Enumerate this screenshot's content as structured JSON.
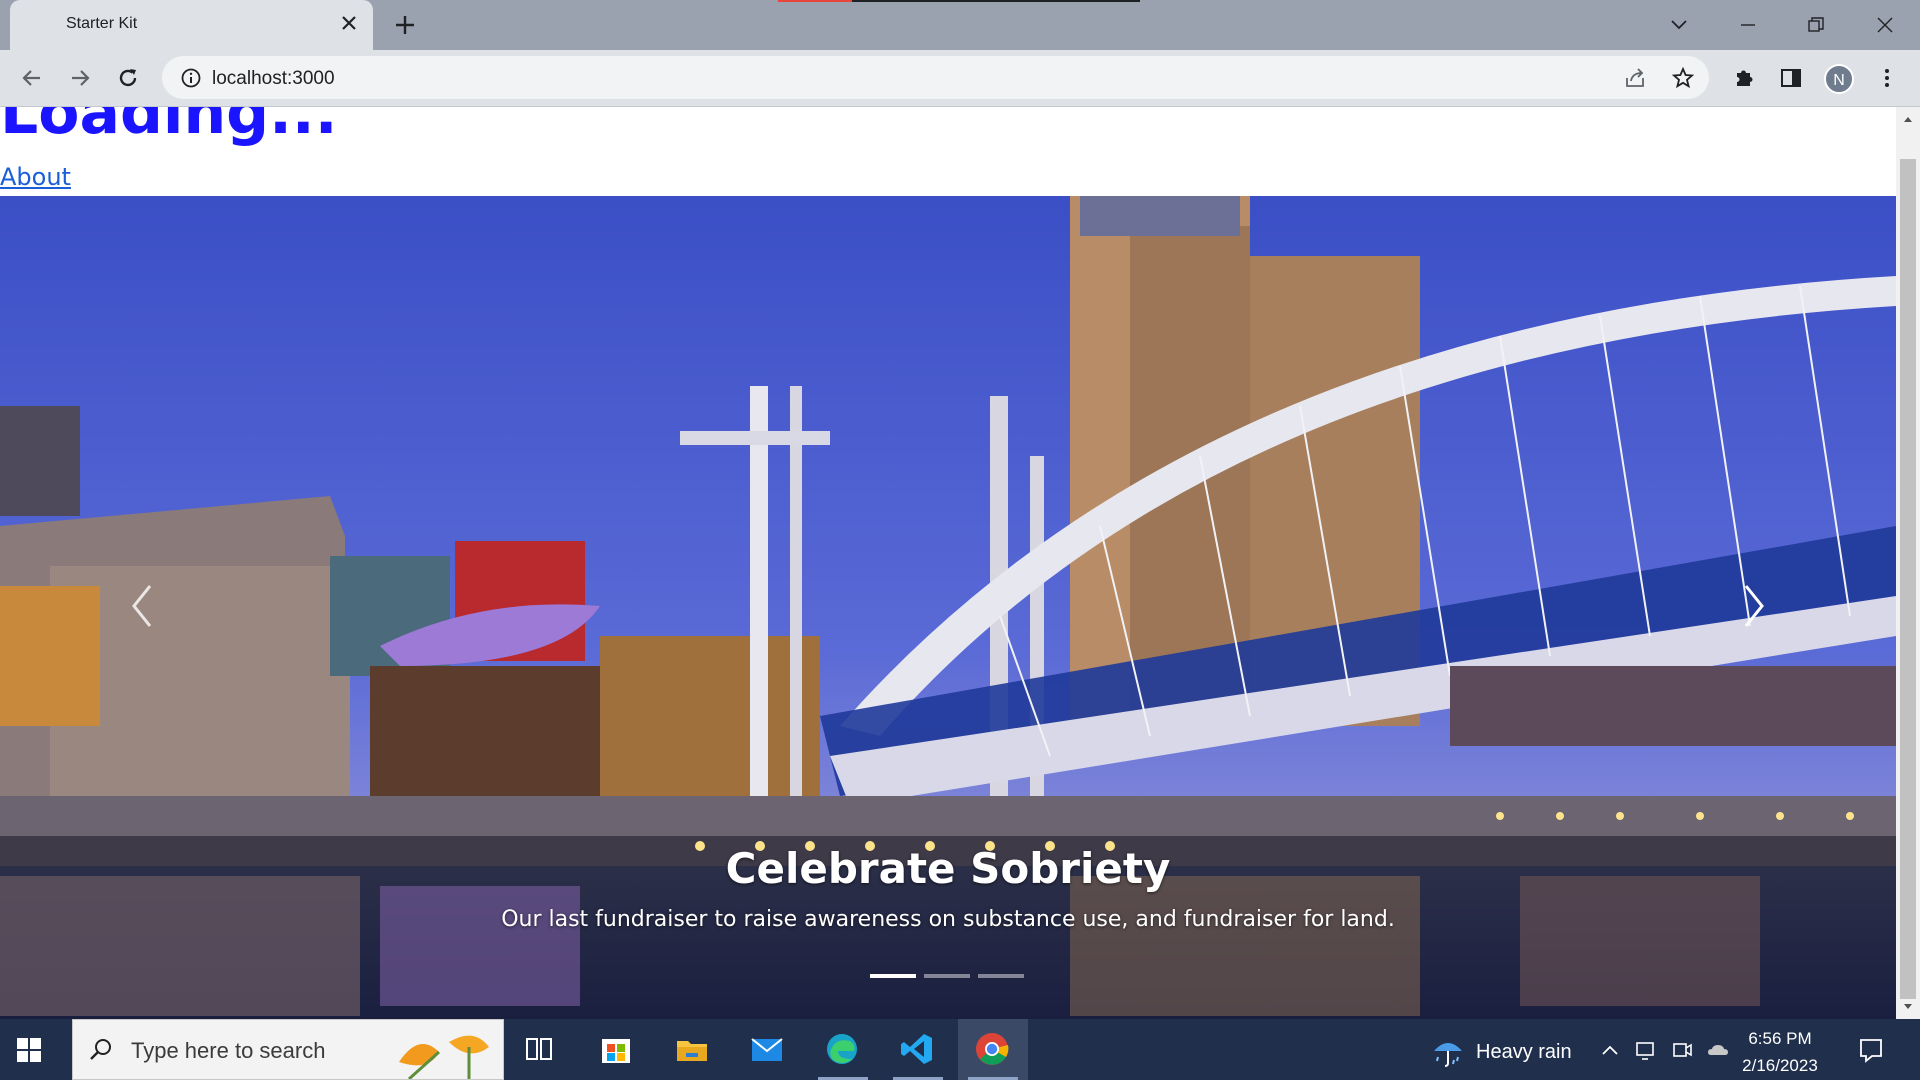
{
  "browser": {
    "tab_title": "Starter Kit",
    "url": "localhost:3000",
    "profile_initial": "N"
  },
  "page": {
    "heading": "Loading...",
    "about_link": "About"
  },
  "carousel": {
    "slide_title": "Celebrate Sobriety",
    "slide_text": "Our last fundraiser to raise awareness on substance use, and fundraiser for land.",
    "slide_count": 3,
    "active_slide": 1
  },
  "taskbar": {
    "search_placeholder": "Type here to search",
    "weather": "Heavy rain",
    "time": "6:56 PM",
    "date": "2/16/2023"
  },
  "icons": [
    "info-icon",
    "share-icon",
    "star-icon",
    "extensions-icon",
    "sidepanel-icon",
    "windows-icon",
    "task-view-icon",
    "store-icon",
    "file-explorer-icon",
    "mail-icon",
    "edge-icon",
    "vscode-icon",
    "chrome-icon",
    "umbrella-icon",
    "notification-icon"
  ]
}
